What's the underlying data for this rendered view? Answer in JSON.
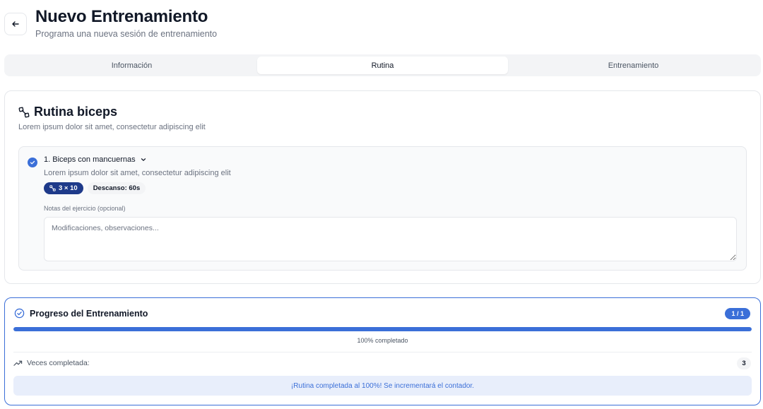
{
  "header": {
    "title": "Nuevo Entrenamiento",
    "subtitle": "Programa una nueva sesión de entrenamiento",
    "back_icon": "arrow-left-icon"
  },
  "tabs": [
    {
      "label": "Información",
      "active": false
    },
    {
      "label": "Rutina",
      "active": true
    },
    {
      "label": "Entrenamiento",
      "active": false
    }
  ],
  "routine": {
    "icon": "dumbbell-icon",
    "title": "Rutina biceps",
    "description": "Lorem ipsum dolor sit amet, consectetur adipiscing elit",
    "exercise": {
      "name": "1. Biceps con mancuernas",
      "description": "Lorem ipsum dolor sit amet, consectetur adipiscing elit",
      "sets_badge": "3 × 10",
      "rest_badge": "Descanso: 60s",
      "notes_label": "Notas del ejercicio (opcional)",
      "notes_placeholder": "Modificaciones, observaciones...",
      "notes_value": "",
      "completed": true
    }
  },
  "progress": {
    "title": "Progreso del Entrenamiento",
    "counter": "1 / 1",
    "percent": 100,
    "percent_text": "100% completado",
    "times_label": "Veces completada:",
    "times_count": "3",
    "banner": "¡Rutina completada al 100%! Se incrementará el contador."
  },
  "colors": {
    "accent": "#3b6fd8",
    "badge_dark": "#1e3a8a",
    "banner_bg": "#e8eefb"
  }
}
